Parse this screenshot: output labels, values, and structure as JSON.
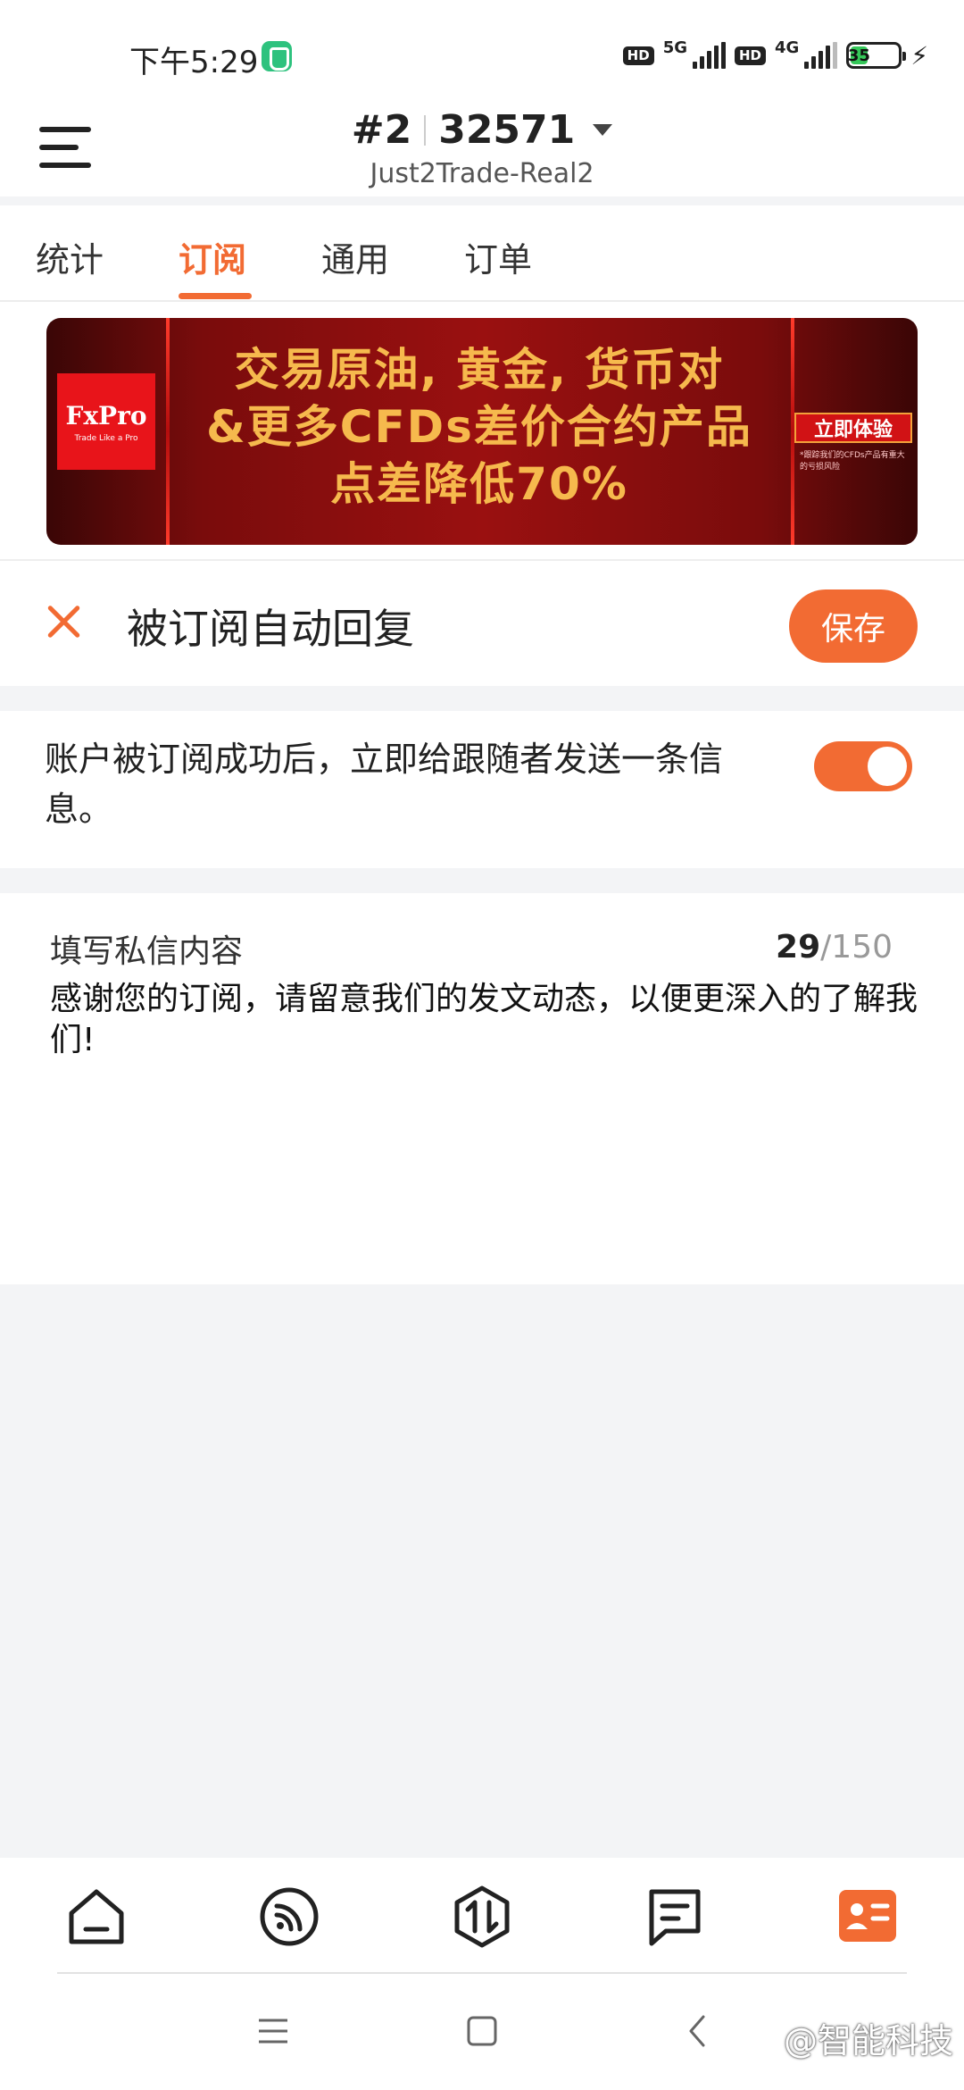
{
  "status_bar": {
    "time": "下午5:29",
    "hd_label_1": "HD",
    "network_1": "5G",
    "hd_label_2": "HD",
    "network_2": "4G",
    "battery_level": "35",
    "battery_color": "#35c759"
  },
  "header": {
    "rank": "#2",
    "account_number": "32571",
    "server": "Just2Trade-Real2"
  },
  "tabs": [
    {
      "label": "统计",
      "active": false
    },
    {
      "label": "订阅",
      "active": true
    },
    {
      "label": "通用",
      "active": false
    },
    {
      "label": "订单",
      "active": false
    }
  ],
  "banner": {
    "logo_main": "FxPro",
    "logo_sub": "Trade Like a Pro",
    "line1": "交易原油, 黄金, 货币对",
    "line2": "&更多CFDs差价合约产品",
    "line3": "点差降低70%",
    "cta": "立即体验",
    "cta_sub": "*跟踪我们的CFDs产品有重大的亏损风险"
  },
  "title_row": {
    "title": "被订阅自动回复",
    "save_label": "保存"
  },
  "toggle_row": {
    "text": "账户被订阅成功后，立即给跟随者发送一条信息。",
    "enabled": true
  },
  "message": {
    "label": "填写私信内容",
    "count_current": "29",
    "count_max": "/150",
    "body": "感谢您的订阅，请留意我们的发文动态，以便更深入的了解我们!"
  },
  "bottom_nav": [
    {
      "icon": "home-icon",
      "active": false
    },
    {
      "icon": "signal-feed-icon",
      "active": false
    },
    {
      "icon": "trade-icon",
      "active": false
    },
    {
      "icon": "message-icon",
      "active": false
    },
    {
      "icon": "profile-card-icon",
      "active": true
    }
  ],
  "watermark": "@智能科技",
  "colors": {
    "accent": "#f26b33",
    "background": "#f3f4f6"
  }
}
